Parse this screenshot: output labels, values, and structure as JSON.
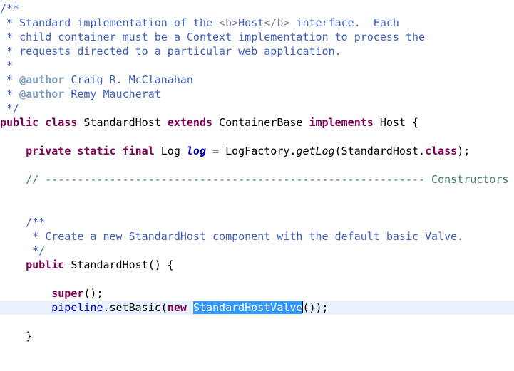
{
  "editor": {
    "colors": {
      "comment": "#3f5fbf",
      "keyword": "#7f0055",
      "line_comment": "#3f7f5f",
      "field": "#0000c0",
      "selection": "#3399ff",
      "current_line": "#e8f2fe"
    },
    "lines": [
      [
        {
          "t": "/**",
          "c": "comment"
        }
      ],
      [
        {
          "t": " * Standard implementation of the ",
          "c": "comment"
        },
        {
          "t": "<b>",
          "c": "comment-tag"
        },
        {
          "t": "Host",
          "c": "comment"
        },
        {
          "t": "</b>",
          "c": "comment-tag"
        },
        {
          "t": " interface.  Each",
          "c": "comment"
        }
      ],
      [
        {
          "t": " * child container must be a Context implementation to process the",
          "c": "comment"
        }
      ],
      [
        {
          "t": " * requests directed to a particular web application.",
          "c": "comment"
        }
      ],
      [
        {
          "t": " *",
          "c": "comment"
        }
      ],
      [
        {
          "t": " * ",
          "c": "comment"
        },
        {
          "t": "@author",
          "c": "javadoc-kw"
        },
        {
          "t": " Craig R. McClanahan",
          "c": "comment"
        }
      ],
      [
        {
          "t": " * ",
          "c": "comment"
        },
        {
          "t": "@author",
          "c": "javadoc-kw"
        },
        {
          "t": " Remy Maucherat",
          "c": "comment"
        }
      ],
      [
        {
          "t": " */",
          "c": "comment"
        }
      ],
      [
        {
          "t": "public",
          "c": "kw"
        },
        {
          "t": " ",
          "c": "plain"
        },
        {
          "t": "class",
          "c": "kw"
        },
        {
          "t": " StandardHost ",
          "c": "plain"
        },
        {
          "t": "extends",
          "c": "kw"
        },
        {
          "t": " ContainerBase ",
          "c": "plain"
        },
        {
          "t": "implements",
          "c": "kw"
        },
        {
          "t": " Host {",
          "c": "plain"
        }
      ],
      [],
      [
        {
          "t": "    ",
          "c": "plain"
        },
        {
          "t": "private",
          "c": "kw"
        },
        {
          "t": " ",
          "c": "plain"
        },
        {
          "t": "static",
          "c": "kw"
        },
        {
          "t": " ",
          "c": "plain"
        },
        {
          "t": "final",
          "c": "kw"
        },
        {
          "t": " Log ",
          "c": "plain"
        },
        {
          "t": "log",
          "c": "static-field"
        },
        {
          "t": " = LogFactory.",
          "c": "plain"
        },
        {
          "t": "getLog",
          "c": "static-method"
        },
        {
          "t": "(StandardHost.",
          "c": "plain"
        },
        {
          "t": "class",
          "c": "kw"
        },
        {
          "t": ");",
          "c": "plain"
        }
      ],
      [],
      [
        {
          "t": "    // ----------------------------------------------------------- Constructors",
          "c": "line-comment"
        }
      ],
      [],
      [],
      [
        {
          "t": "    /**",
          "c": "comment"
        }
      ],
      [
        {
          "t": "     * Create a new StandardHost component with the default basic Valve.",
          "c": "comment"
        }
      ],
      [
        {
          "t": "     */",
          "c": "comment"
        }
      ],
      [
        {
          "t": "    ",
          "c": "plain"
        },
        {
          "t": "public",
          "c": "kw"
        },
        {
          "t": " StandardHost() {",
          "c": "plain"
        }
      ],
      [],
      [
        {
          "t": "        ",
          "c": "plain"
        },
        {
          "t": "super",
          "c": "kw"
        },
        {
          "t": "();",
          "c": "plain"
        }
      ],
      [
        {
          "t": "        ",
          "c": "plain"
        },
        {
          "t": "pipeline",
          "c": "field"
        },
        {
          "t": ".setBasic(",
          "c": "plain"
        },
        {
          "t": "new",
          "c": "kw"
        },
        {
          "t": " ",
          "c": "plain"
        },
        {
          "t": "StandardHostValve",
          "c": "selected"
        },
        {
          "t": "",
          "c": "caret"
        },
        {
          "t": "());",
          "c": "plain"
        }
      ],
      [],
      [
        {
          "t": "    }",
          "c": "plain"
        }
      ]
    ],
    "current_line_index": 21
  }
}
